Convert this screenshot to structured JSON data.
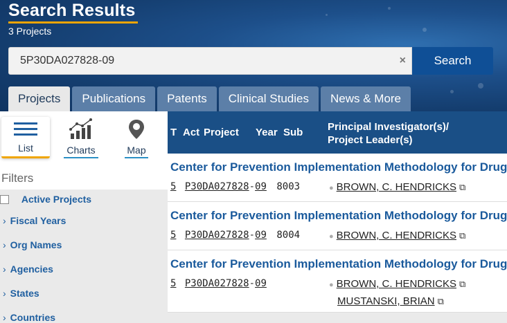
{
  "header": {
    "title": "Search Results",
    "subtitle": "3 Projects"
  },
  "search": {
    "value": "5P30DA027828-09",
    "clear_label": "×",
    "button_label": "Search"
  },
  "tabs": [
    {
      "label": "Projects",
      "active": true
    },
    {
      "label": "Publications"
    },
    {
      "label": "Patents"
    },
    {
      "label": "Clinical Studies"
    },
    {
      "label": "News & More"
    }
  ],
  "views": {
    "list_label": "List",
    "charts_label": "Charts",
    "map_label": "Map"
  },
  "filters": {
    "heading": "Filters",
    "active_projects": "Active Projects",
    "items": [
      "Fiscal Years",
      "Org Names",
      "Agencies",
      "States",
      "Countries"
    ]
  },
  "table": {
    "col_t": "T",
    "col_act": "Act",
    "col_project": "Project",
    "col_year": "Year",
    "col_sub": "Sub",
    "col_pi_1": "Principal Investigator(s)/",
    "col_pi_2": "Project Leader(s)"
  },
  "rows": [
    {
      "title": "Center for Prevention Implementation Methodology for Drug",
      "t": "5",
      "act": "P30",
      "proj": "DA027828",
      "year": "09",
      "sub": "8003",
      "pis": [
        "BROWN, C. HENDRICKS"
      ]
    },
    {
      "title": "Center for Prevention Implementation Methodology for Drug",
      "t": "5",
      "act": "P30",
      "proj": "DA027828",
      "year": "09",
      "sub": "8004",
      "pis": [
        "BROWN, C. HENDRICKS"
      ]
    },
    {
      "title": "Center for Prevention Implementation Methodology for Drug",
      "t": "5",
      "act": "P30",
      "proj": "DA027828",
      "year": "09",
      "sub": "",
      "pis": [
        "BROWN, C. HENDRICKS",
        "MUSTANSKI, BRIAN"
      ]
    }
  ],
  "colors": {
    "accent": "#f0a500",
    "primary": "#0f4f96",
    "header_bg": "#1a4f86",
    "link": "#1a5a9c"
  }
}
